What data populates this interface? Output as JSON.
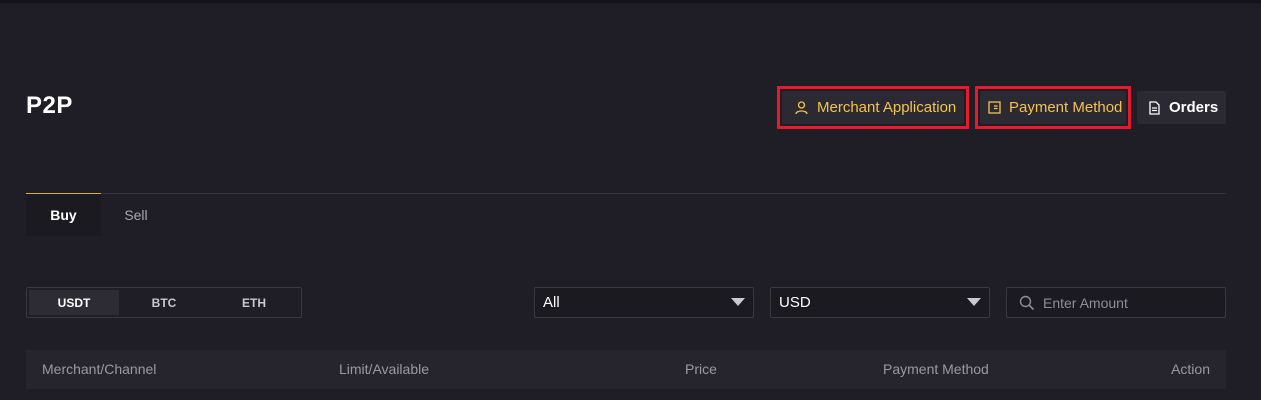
{
  "page": {
    "title": "P2P"
  },
  "header_actions": {
    "merchant_application": {
      "label": "Merchant Application",
      "icon": "user-icon"
    },
    "payment_method": {
      "label": "Payment Method",
      "icon": "wallet-icon"
    },
    "orders": {
      "label": "Orders",
      "icon": "document-icon"
    }
  },
  "tabs": [
    {
      "label": "Buy",
      "active": true
    },
    {
      "label": "Sell",
      "active": false
    }
  ],
  "coins": [
    {
      "label": "USDT",
      "active": true
    },
    {
      "label": "BTC",
      "active": false
    },
    {
      "label": "ETH",
      "active": false
    }
  ],
  "filters": {
    "payment_select": {
      "value": "All"
    },
    "currency_select": {
      "value": "USD"
    },
    "amount_search": {
      "placeholder": "Enter Amount",
      "value": ""
    }
  },
  "table": {
    "columns": [
      "Merchant/Channel",
      "Limit/Available",
      "Price",
      "Payment Method",
      "Action"
    ]
  },
  "colors": {
    "background": "#1f1e26",
    "accent_gold": "#f5c24d",
    "highlight_red": "#e8192c"
  }
}
